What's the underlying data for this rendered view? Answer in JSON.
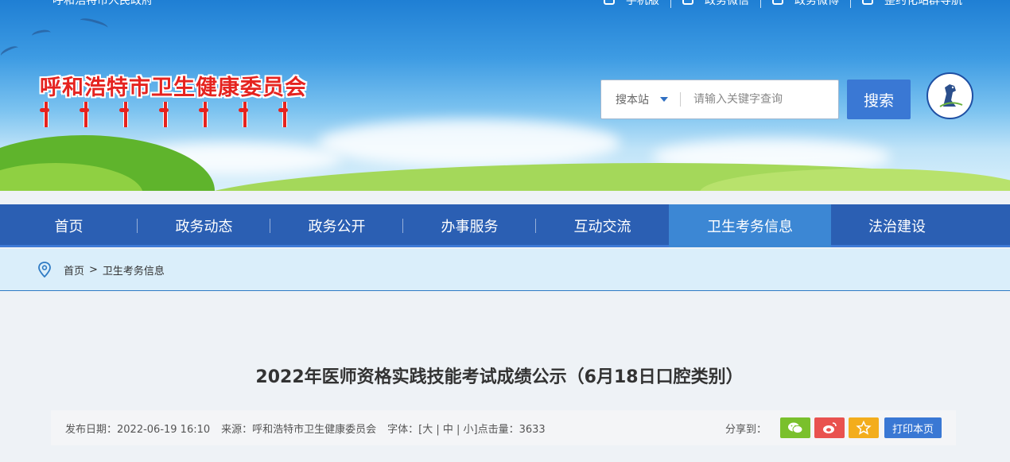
{
  "header": {
    "gov_link": "呼和浩特市人民政府",
    "top_links": [
      {
        "label": "手机版",
        "icon": "mobile-icon"
      },
      {
        "label": "政务微信",
        "icon": "wechat-icon"
      },
      {
        "label": "政务微博",
        "icon": "weibo-icon"
      },
      {
        "label": "整约化站群导航",
        "icon": "navigation-icon"
      }
    ],
    "site_title": "呼和浩特市卫生健康委员会",
    "emblem_icon": "horse-emblem-icon"
  },
  "search": {
    "scope": "搜本站",
    "placeholder": "请输入关键字查询",
    "button": "搜索"
  },
  "nav": {
    "items": [
      {
        "label": "首页",
        "active": false
      },
      {
        "label": "政务动态",
        "active": false
      },
      {
        "label": "政务公开",
        "active": false
      },
      {
        "label": "办事服务",
        "active": false
      },
      {
        "label": "互动交流",
        "active": false
      },
      {
        "label": "卫生考务信息",
        "active": true
      },
      {
        "label": "法治建设",
        "active": false
      }
    ]
  },
  "breadcrumb": {
    "home": "首页",
    "separator": ">",
    "current": "卫生考务信息"
  },
  "article": {
    "title": "2022年医师资格实践技能考试成绩公示（6月18日口腔类别）",
    "meta": {
      "date": "发布日期：2022-06-19 16:10",
      "source": "来源：呼和浩特市卫生健康委员会",
      "font": "字体：[大 | 中 | 小]点击量：3633"
    },
    "share_label": "分享到：",
    "share_buttons": [
      {
        "icon": "wechat-share-icon",
        "color": "#7ac02c"
      },
      {
        "icon": "weibo-share-icon",
        "color": "#e9524f"
      },
      {
        "icon": "favorite-star-icon",
        "color": "#f3ad1c"
      }
    ],
    "print_label": "打印本页"
  },
  "colors": {
    "nav_bg": "#2b5fb3",
    "nav_active": "#3c87d4",
    "title_red": "#e5231f",
    "button_blue": "#3a78d4"
  }
}
